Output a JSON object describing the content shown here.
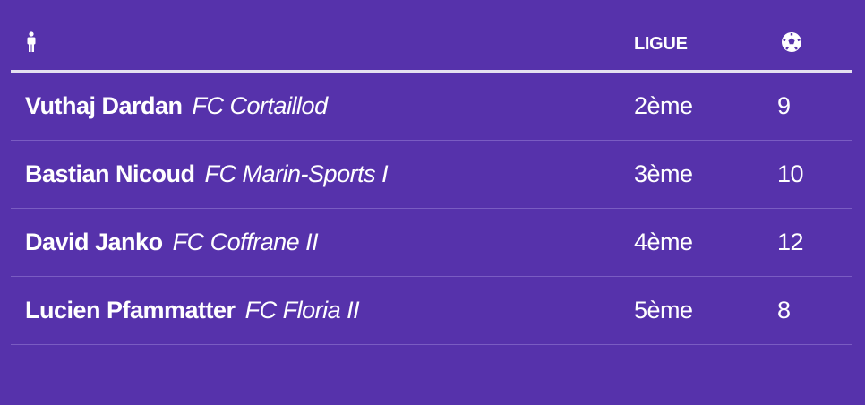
{
  "table": {
    "headers": {
      "player_icon": "person-icon",
      "league_label": "LIGUE",
      "goals_icon": "soccer-ball-icon"
    },
    "rows": [
      {
        "name": "Vuthaj Dardan",
        "club": "FC Cortaillod",
        "league": "2ème",
        "goals": "9"
      },
      {
        "name": "Bastian Nicoud",
        "club": "FC Marin-Sports I",
        "league": "3ème",
        "goals": "10"
      },
      {
        "name": "David Janko",
        "club": "FC Coffrane II",
        "league": "4ème",
        "goals": "12"
      },
      {
        "name": "Lucien Pfammatter",
        "club": "FC Floria II",
        "league": "5ème",
        "goals": "8"
      }
    ]
  },
  "colors": {
    "background": "#5632ab",
    "text": "#ffffff",
    "header_rule": "#e4e0f0",
    "row_divider": "#7a5cc2"
  }
}
